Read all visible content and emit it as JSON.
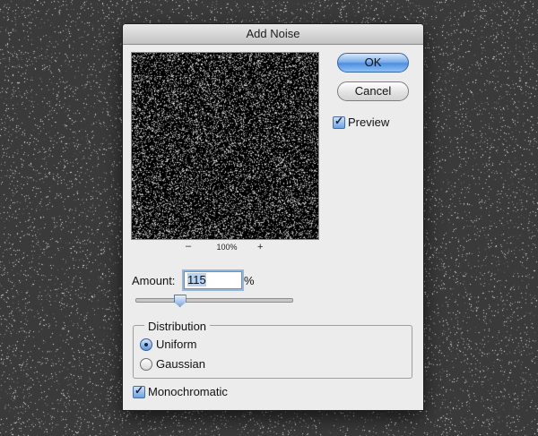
{
  "dialog": {
    "title": "Add Noise"
  },
  "preview": {
    "zoom_out": "–",
    "zoom_level": "100%",
    "zoom_in": "+"
  },
  "buttons": {
    "ok": "OK",
    "cancel": "Cancel"
  },
  "options": {
    "preview_label": "Preview",
    "preview_checked": true,
    "monochromatic_label": "Monochromatic",
    "monochromatic_checked": true
  },
  "amount": {
    "label": "Amount:",
    "value": "115",
    "unit": "%",
    "slider_fraction": 0.28
  },
  "distribution": {
    "title": "Distribution",
    "options": [
      "Uniform",
      "Gaussian"
    ],
    "selected": "Uniform"
  },
  "colors": {
    "accent": "#5b9ae6",
    "dialog_bg": "#ececec",
    "backdrop": "#3a3a3a"
  }
}
